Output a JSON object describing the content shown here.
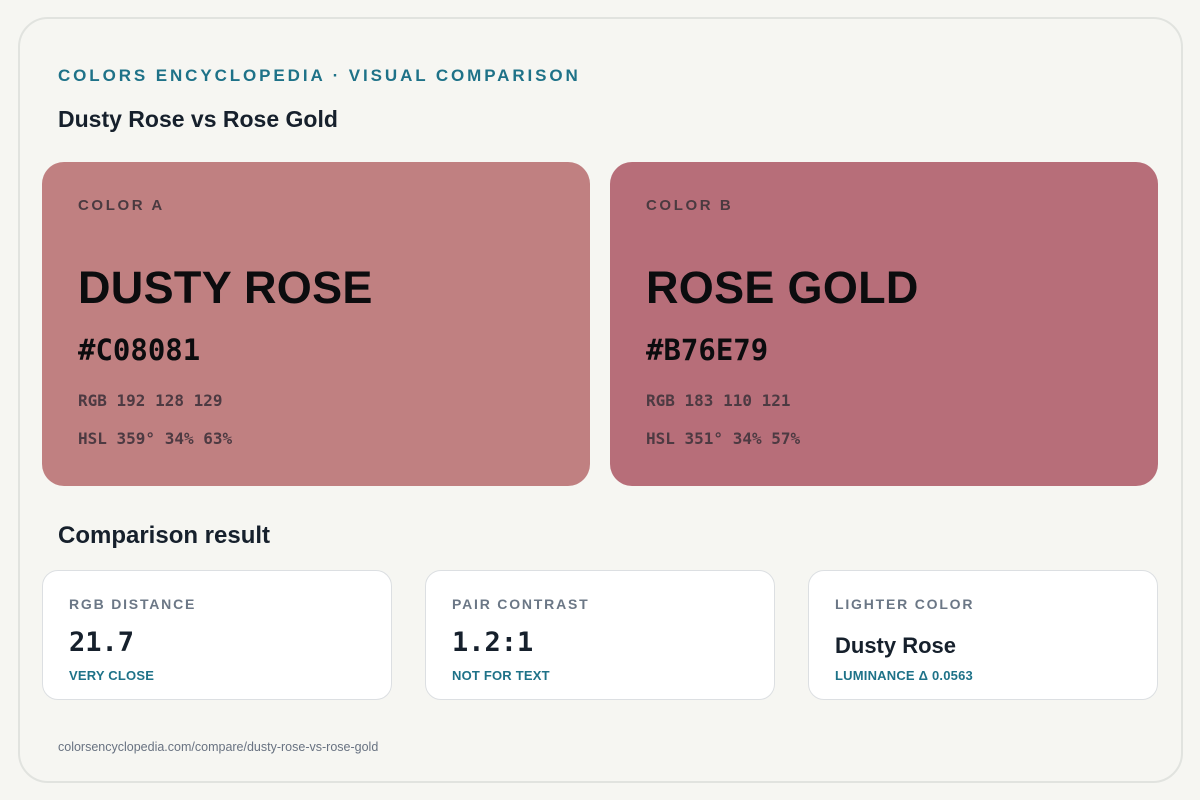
{
  "header": {
    "eyebrow": "COLORS ENCYCLOPEDIA · VISUAL COMPARISON",
    "title": "Dusty Rose vs Rose Gold"
  },
  "colors": [
    {
      "label": "COLOR A",
      "name": "DUSTY ROSE",
      "hex": "#C08081",
      "rgb": "RGB 192 128 129",
      "hsl": "HSL 359° 34% 63%",
      "swatch_color": "#C08081"
    },
    {
      "label": "COLOR B",
      "name": "ROSE GOLD",
      "hex": "#B76E79",
      "rgb": "RGB 183 110 121",
      "hsl": "HSL 351° 34% 57%",
      "swatch_color": "#B76E79"
    }
  ],
  "comparison": {
    "title": "Comparison result",
    "cards": [
      {
        "label": "RGB DISTANCE",
        "value": "21.7",
        "note": "VERY CLOSE"
      },
      {
        "label": "PAIR CONTRAST",
        "value": "1.2:1",
        "note": "NOT FOR TEXT"
      },
      {
        "label": "LIGHTER COLOR",
        "value": "Dusty Rose",
        "note": "LUMINANCE Δ 0.0563"
      }
    ]
  },
  "footer": {
    "url": "colorsencyclopedia.com/compare/dusty-rose-vs-rose-gold"
  },
  "theme": {
    "accent": "#1E7288",
    "background": "#F6F6F2",
    "card_background": "#FFFFFF"
  }
}
